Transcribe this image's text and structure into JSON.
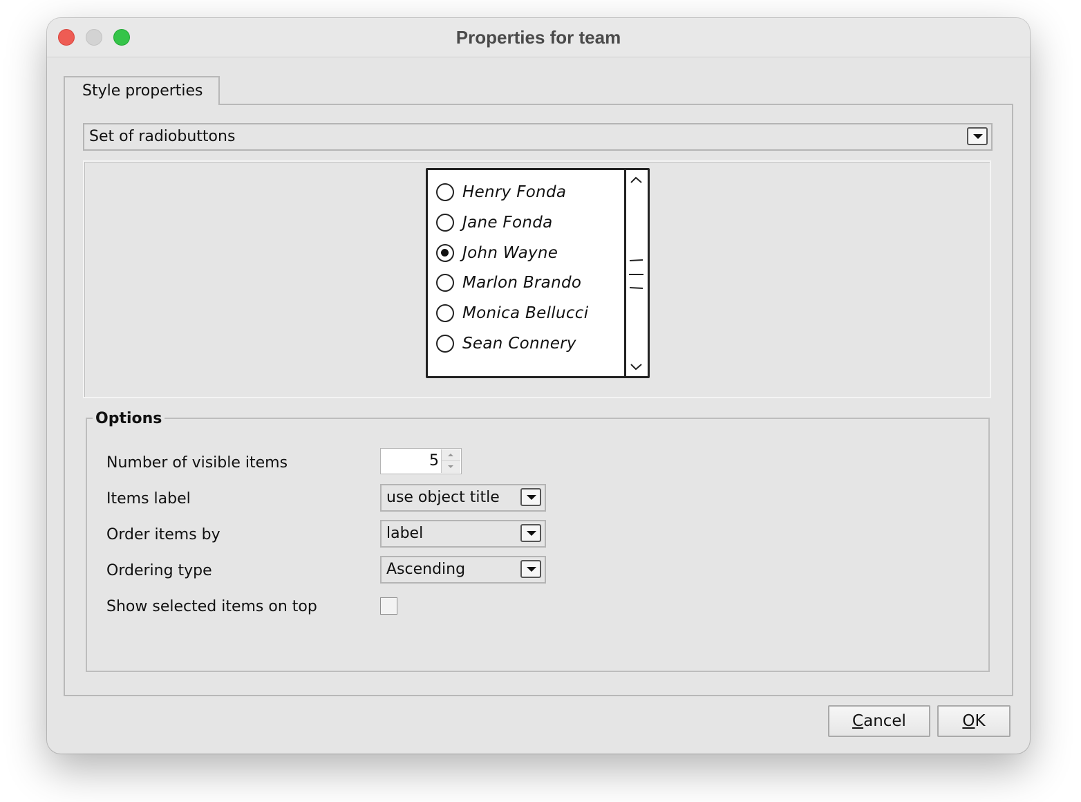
{
  "window": {
    "title": "Properties for team"
  },
  "tabs": [
    {
      "label": "Style properties",
      "active": true
    }
  ],
  "style_select": {
    "value": "Set of radiobuttons"
  },
  "preview": {
    "items": [
      {
        "label": "Henry Fonda",
        "checked": false
      },
      {
        "label": "Jane Fonda",
        "checked": false
      },
      {
        "label": "John Wayne",
        "checked": true
      },
      {
        "label": "Marlon Brando",
        "checked": false
      },
      {
        "label": "Monica Bellucci",
        "checked": false
      },
      {
        "label": "Sean Connery",
        "checked": false
      }
    ]
  },
  "options": {
    "legend": "Options",
    "visible_items": {
      "label": "Number of visible items",
      "value": "5"
    },
    "items_label": {
      "label": "Items label",
      "value": "use object title"
    },
    "order_by": {
      "label": "Order items by",
      "value": "label"
    },
    "ordering_type": {
      "label": "Ordering type",
      "value": "Ascending"
    },
    "show_selected": {
      "label": "Show selected items on top",
      "checked": false
    }
  },
  "buttons": {
    "cancel_first": "C",
    "cancel_rest": "ancel",
    "ok_first": "O",
    "ok_rest": "K"
  }
}
